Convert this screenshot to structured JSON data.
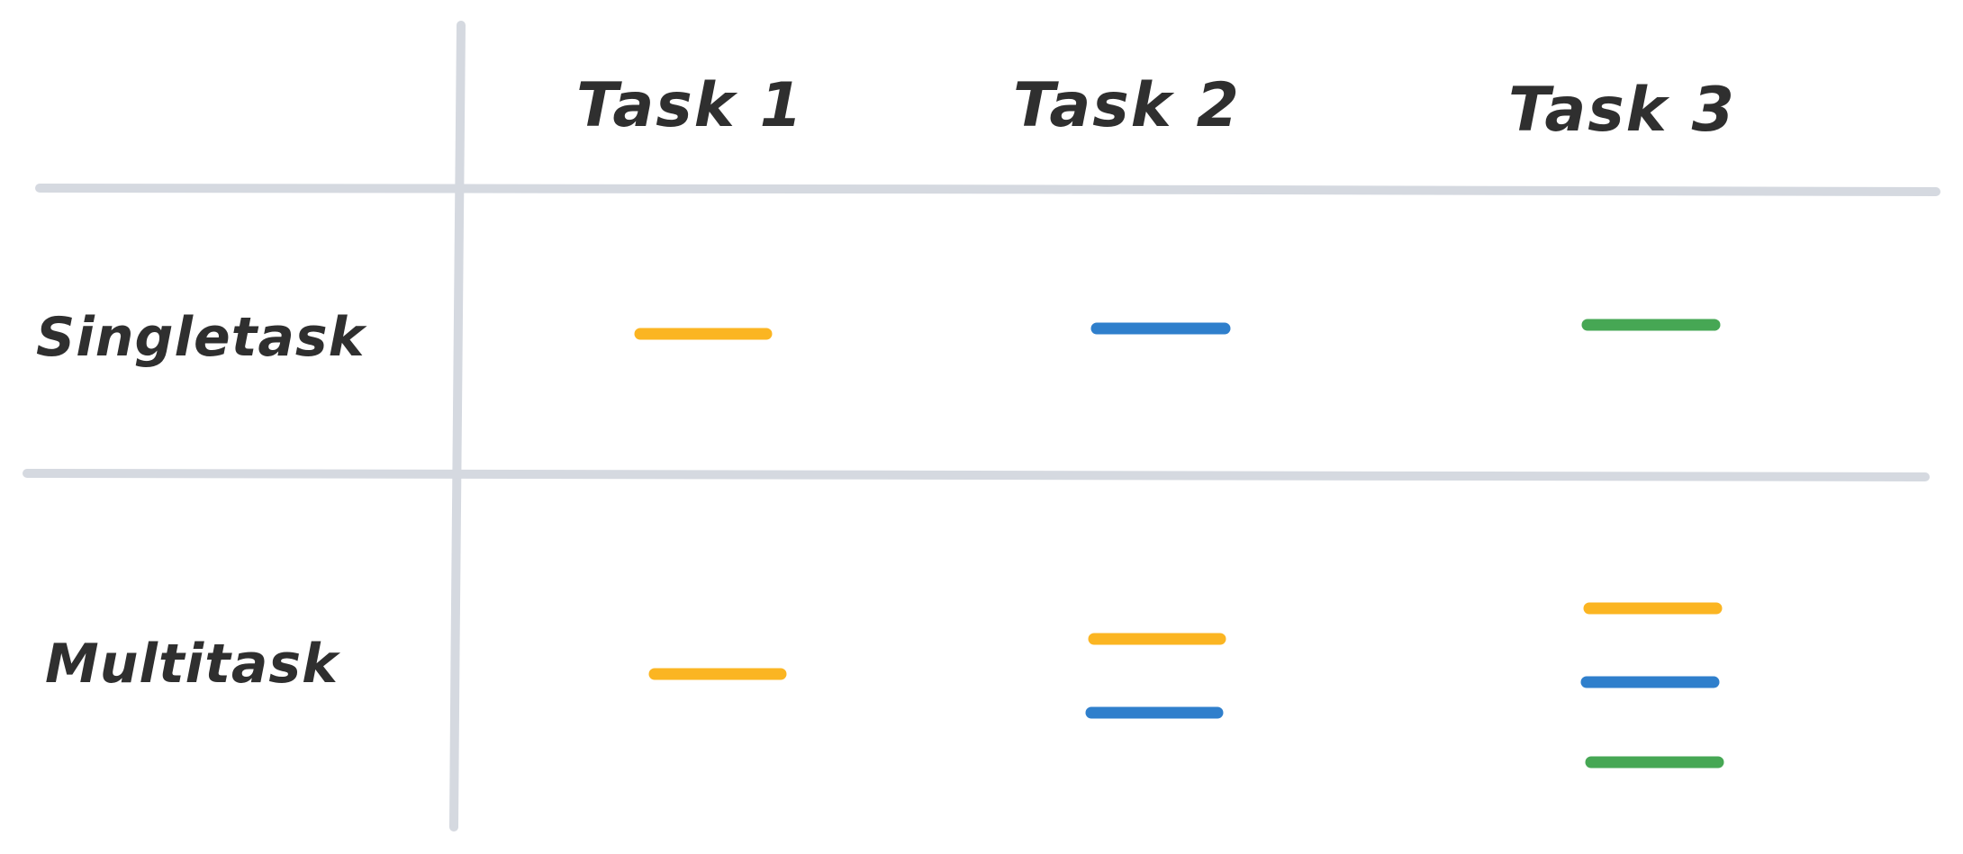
{
  "columns": [
    {
      "label": "Task 1"
    },
    {
      "label": "Task 2"
    },
    {
      "label": "Task 3"
    }
  ],
  "rows": [
    {
      "label": "Singletask"
    },
    {
      "label": "Multitask"
    }
  ],
  "colors": {
    "grid": "#d5d9e0",
    "text": "#2f2f2f",
    "task1": "#fbb522",
    "task2": "#2f7fcc",
    "task3": "#46a754"
  },
  "cells": [
    {
      "row": "Singletask",
      "column": "Task 1",
      "bars": [
        "task1"
      ]
    },
    {
      "row": "Singletask",
      "column": "Task 2",
      "bars": [
        "task2"
      ]
    },
    {
      "row": "Singletask",
      "column": "Task 3",
      "bars": [
        "task3"
      ]
    },
    {
      "row": "Multitask",
      "column": "Task 1",
      "bars": [
        "task1"
      ]
    },
    {
      "row": "Multitask",
      "column": "Task 2",
      "bars": [
        "task1",
        "task2"
      ]
    },
    {
      "row": "Multitask",
      "column": "Task 3",
      "bars": [
        "task1",
        "task2",
        "task3"
      ]
    }
  ]
}
